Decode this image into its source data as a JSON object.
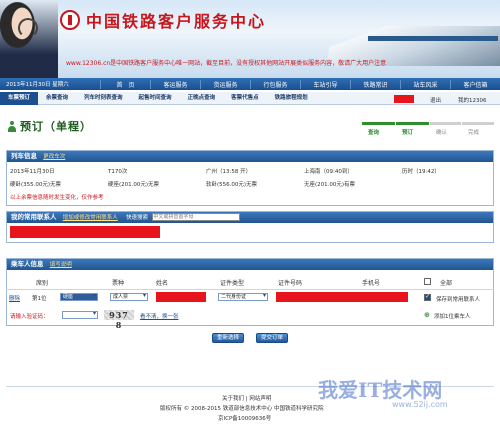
{
  "banner": {
    "site_title": "中国铁路客户服务中心",
    "notice": "www.12306.cn是中国铁路客户服务中心唯一网站，截至目前，没有授权其他网站开展类似服务内容，敬请广大用户注意"
  },
  "navbar": {
    "date": "2013年11月30日 星期六",
    "items": [
      "首　页",
      "客运服务",
      "货运服务",
      "行包服务",
      "车站引导",
      "铁路常识",
      "站车风采",
      "客户信箱"
    ]
  },
  "subnav": {
    "items": [
      "车票预订",
      "余票查询",
      "列车时刻表查询",
      "起售时间查询",
      "正晚点查询",
      "客票代售点",
      "铁路旅程规划"
    ],
    "active_index": 0,
    "logout": "退出",
    "my12306": "我的12306"
  },
  "page": {
    "title": "预订（单程）",
    "steps": [
      "查询",
      "预订",
      "确认",
      "完成"
    ],
    "current_step": 2
  },
  "train_info": {
    "header": "列车信息",
    "change_link": "更改车次",
    "date": "2013年11月30日",
    "train_no": "T170次",
    "from": "广州（13:58 开）",
    "to": "上海南（09:40到）",
    "duration": "历时（19:42）",
    "seats": [
      "硬卧(355.00元)无票",
      "硬座(201.00元)无票",
      "软卧(556.00元)无票",
      "无座(201.00元)有票"
    ],
    "warning": "以上余票信息随时发生变化，仅作参考"
  },
  "contacts": {
    "header": "我的常用联系人",
    "link": "增加或修改常用联系人",
    "search_label": "快速搜索",
    "search_placeholder": "中文或拼音首字母"
  },
  "passenger": {
    "header": "乘车人信息",
    "help_link": "填写说明",
    "columns": {
      "seat_no": "席别",
      "ticket_type": "票种",
      "name": "姓名",
      "id_type": "证件类型",
      "id_no": "证件号码",
      "phone": "手机号",
      "all": "全部"
    },
    "delete_link": "删除",
    "seat_no_label": "第1位",
    "seat_value": "硬座",
    "ticket_value": "成人票",
    "id_type_value": "二代身份证",
    "save_label": "保存到常用联系人",
    "add_label": "添加1位乘车人",
    "captcha_label": "请输入验证码：",
    "captcha_code": "937 8",
    "captcha_refresh": "看不清，换一张"
  },
  "buttons": {
    "reset": "重新选择",
    "submit": "提交订单"
  },
  "footer": {
    "links": "关于我们 | 网站声明",
    "copyright": "版权所有 © 2008-2015 铁道部信息技术中心 中国铁道科学研究院",
    "icp": "京ICP备10009636号"
  },
  "watermark": {
    "text": "我爱IT技术网",
    "url": "www.52ij.com"
  }
}
